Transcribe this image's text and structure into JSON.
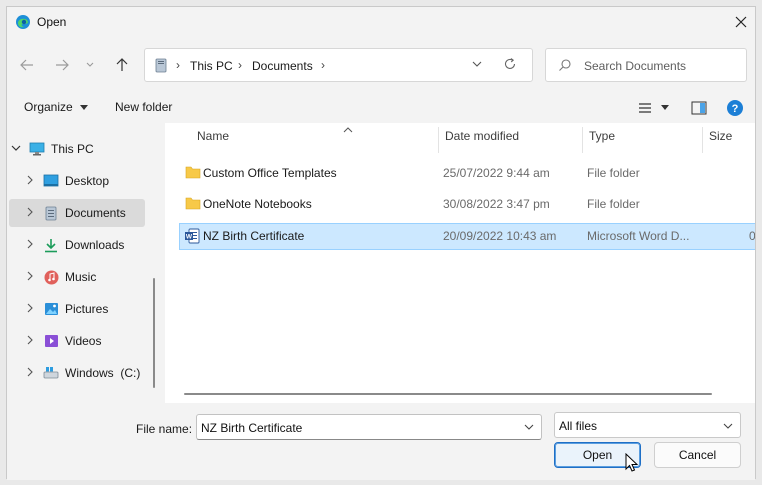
{
  "window": {
    "title": "Open"
  },
  "nav": {
    "path": [
      "This PC",
      "Documents"
    ],
    "search_placeholder": "Search Documents"
  },
  "commands": {
    "organize": "Organize",
    "new_folder": "New folder"
  },
  "tree": [
    {
      "label": "This PC",
      "icon": "computer-icon",
      "expanded": true
    },
    {
      "label": "Desktop",
      "icon": "desktop-icon"
    },
    {
      "label": "Documents",
      "icon": "documents-icon",
      "selected": true
    },
    {
      "label": "Downloads",
      "icon": "downloads-icon"
    },
    {
      "label": "Music",
      "icon": "music-icon"
    },
    {
      "label": "Pictures",
      "icon": "pictures-icon"
    },
    {
      "label": "Videos",
      "icon": "videos-icon"
    },
    {
      "label": "Windows  (C:)",
      "icon": "drive-icon"
    }
  ],
  "columns": {
    "name": "Name",
    "date": "Date modified",
    "type": "Type",
    "size": "Size"
  },
  "files": [
    {
      "name": "Custom Office Templates",
      "date": "25/07/2022 9:44 am",
      "type": "File folder",
      "size": "",
      "icon": "folder-icon"
    },
    {
      "name": "OneNote Notebooks",
      "date": "30/08/2022 3:47 pm",
      "type": "File folder",
      "size": "",
      "icon": "folder-icon"
    },
    {
      "name": "NZ Birth Certificate",
      "date": "20/09/2022 10:43 am",
      "type": "Microsoft Word D...",
      "size": "0",
      "icon": "word-doc-icon",
      "selected": true
    }
  ],
  "bottom": {
    "file_name_label": "File name:",
    "file_name_value": "NZ Birth Certificate",
    "filter_value": "All files",
    "open_label": "Open",
    "cancel_label": "Cancel"
  },
  "colors": {
    "accent": "#0067c0",
    "selection": "#cce8ff",
    "folder": "#f7c948"
  }
}
